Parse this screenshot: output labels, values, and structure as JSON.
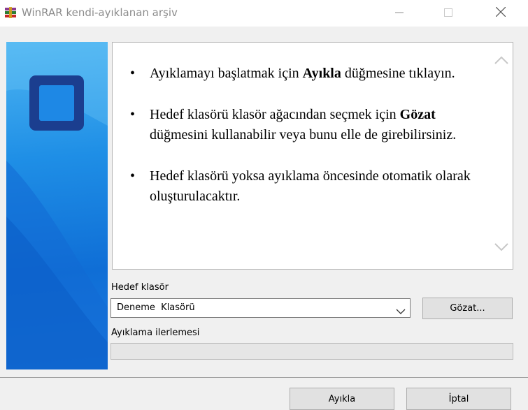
{
  "window": {
    "title": "WinRAR kendi-ayıklanan arşiv",
    "icon": "winrar-books-icon",
    "controls": [
      "minimize-icon",
      "maximize-icon",
      "close-icon"
    ]
  },
  "info": {
    "bullet1": {
      "pre": "Ayıklamayı başlatmak için ",
      "bold": "Ayıkla",
      "post": " düğmesine tıklayın."
    },
    "bullet2": {
      "pre": "Hedef klasörü klasör ağacından seçmek için ",
      "bold": "Gözat",
      "post": " düğmesini kullanabilir veya bunu elle de girebilirsiniz."
    },
    "bullet3": {
      "text": "Hedef klasörü yoksa ayıklama öncesinde otomatik olarak oluşturulacaktır."
    }
  },
  "destination": {
    "label": "Hedef klasör",
    "value": "Deneme  Klasörü",
    "browse_label": "Gözat..."
  },
  "progress": {
    "label": "Ayıklama ilerlemesi",
    "fraction": 0
  },
  "buttons": {
    "extract_label": "Ayıkla",
    "cancel_label": "İptal"
  },
  "colors": {
    "banner_blue": "#1f8fe6",
    "logo_dark": "#1b3e8f",
    "button_face": "#e1e1e1"
  }
}
